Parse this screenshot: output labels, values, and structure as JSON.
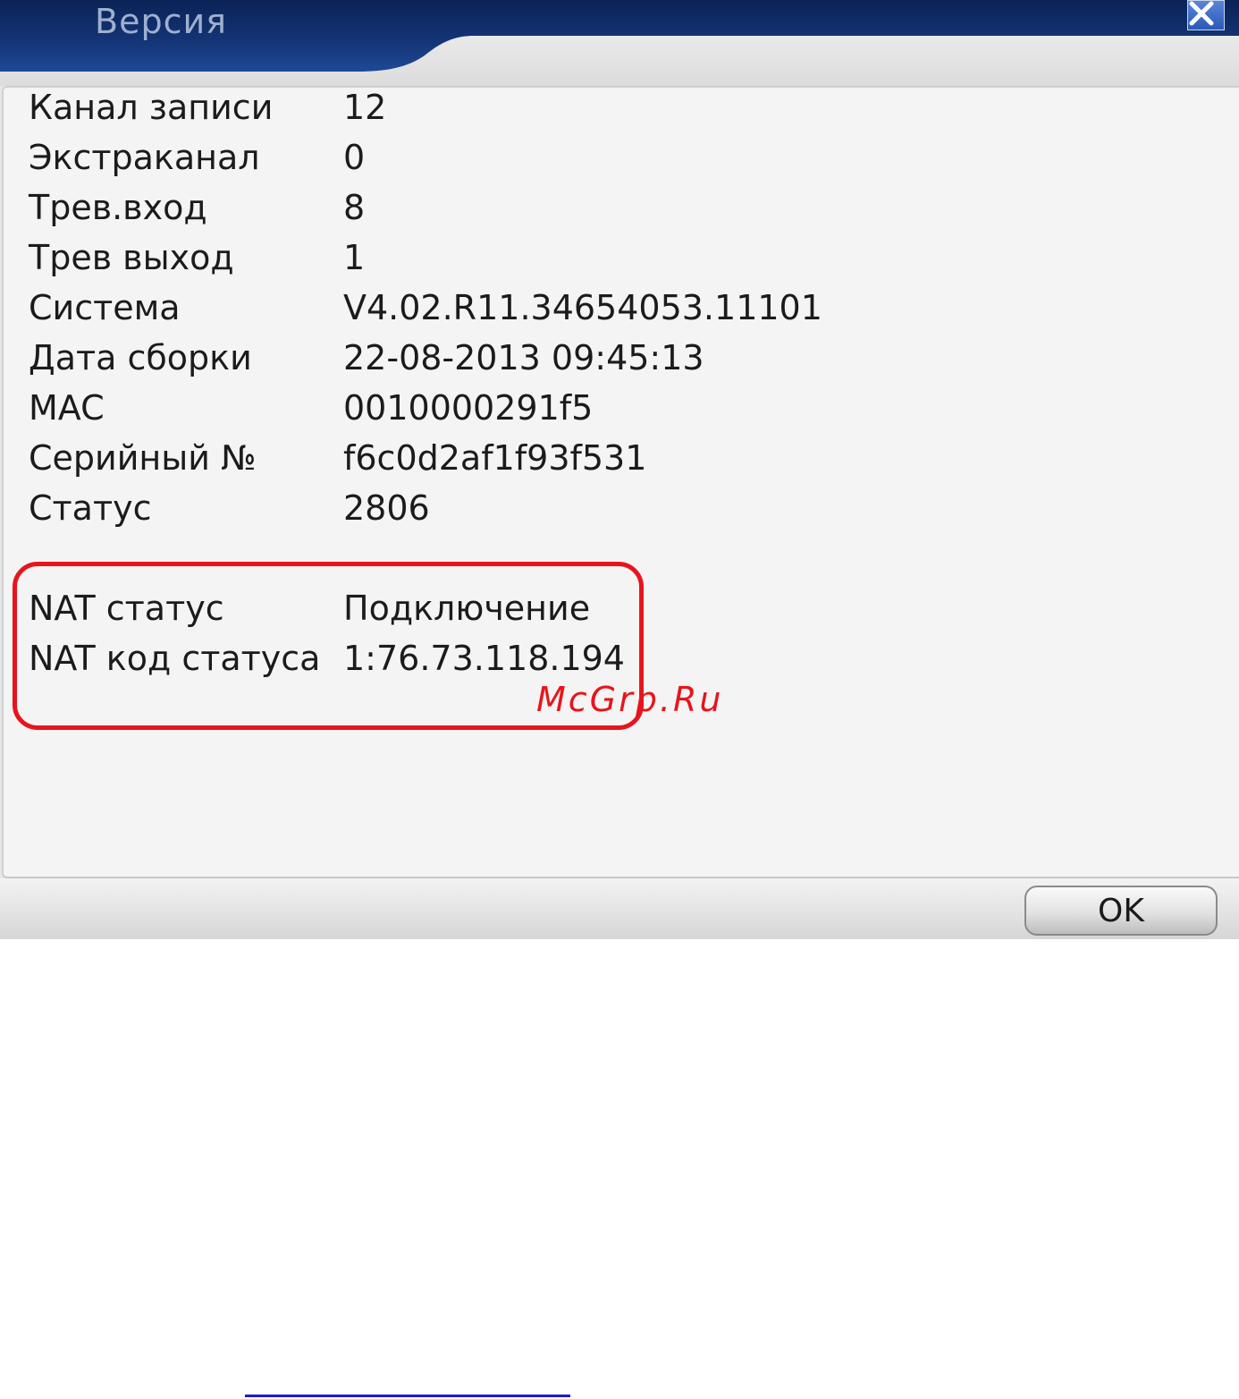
{
  "dialog": {
    "title": "Версия",
    "close_icon": "close-icon",
    "ok_label": "OK"
  },
  "info_rows": [
    {
      "label": "Канал записи",
      "value": "12"
    },
    {
      "label": "Экстраканал",
      "value": "0"
    },
    {
      "label": "Трев.вход",
      "value": "8"
    },
    {
      "label": "Трев выход",
      "value": "1"
    },
    {
      "label": "Система",
      "value": "V4.02.R11.34654053.11101"
    },
    {
      "label": "Дата сборки",
      "value": "22-08-2013 09:45:13"
    },
    {
      "label": "MAC",
      "value": "0010000291f5"
    },
    {
      "label": "Серийный №",
      "value": "f6c0d2af1f93f531"
    },
    {
      "label": "Статус",
      "value": "2806"
    }
  ],
  "nat_rows": [
    {
      "label": "NAT статус",
      "value": "Подключение"
    },
    {
      "label": "NAT код статуса",
      "value": "1:76.73.118.194"
    }
  ],
  "watermark": "McGrp.Ru",
  "colors": {
    "title_bar": "#0d2a63",
    "highlight": "#e8141c",
    "panel": "#f4f4f4"
  }
}
